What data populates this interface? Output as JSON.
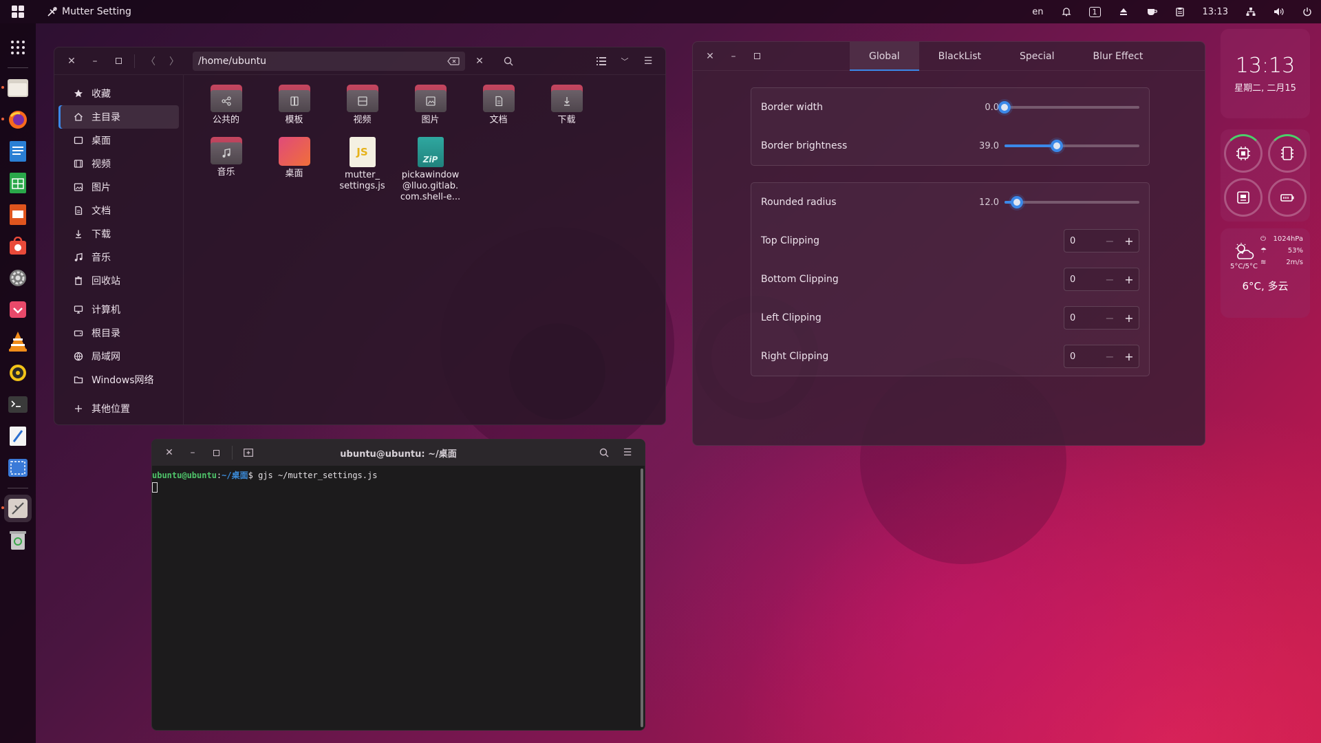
{
  "topbar": {
    "app_name": "Mutter Setting",
    "lang": "en",
    "time": "13:13",
    "workspace": "1"
  },
  "dock": {
    "items": [
      "files-icon",
      "firefox-icon",
      "writer-icon",
      "calc-icon",
      "impress-icon",
      "software-icon",
      "settings-icon",
      "gnome-extension-icon",
      "vlc-icon",
      "rhythmbox-icon",
      "terminal-icon",
      "text-editor-icon",
      "screenshot-icon",
      "mutter-setting-icon",
      "trash-icon"
    ]
  },
  "file_manager": {
    "path": "/home/ubuntu",
    "sidebar": [
      {
        "label": "收藏",
        "icon": "star-icon"
      },
      {
        "label": "主目录",
        "icon": "home-icon",
        "selected": true
      },
      {
        "label": "桌面",
        "icon": "desktop-icon"
      },
      {
        "label": "视频",
        "icon": "video-icon"
      },
      {
        "label": "图片",
        "icon": "picture-icon"
      },
      {
        "label": "文档",
        "icon": "document-icon"
      },
      {
        "label": "下载",
        "icon": "download-icon"
      },
      {
        "label": "音乐",
        "icon": "music-icon"
      },
      {
        "label": "回收站",
        "icon": "trash-icon"
      },
      {
        "label": "计算机",
        "icon": "computer-icon"
      },
      {
        "label": "根目录",
        "icon": "drive-icon"
      },
      {
        "label": "局域网",
        "icon": "network-icon"
      },
      {
        "label": "Windows网络",
        "icon": "folder-icon"
      },
      {
        "label": "其他位置",
        "icon": "plus-icon"
      }
    ],
    "files": [
      {
        "label": "公共的",
        "type": "folder",
        "glyph": "share"
      },
      {
        "label": "模板",
        "type": "folder",
        "glyph": "template"
      },
      {
        "label": "视频",
        "type": "folder",
        "glyph": "video"
      },
      {
        "label": "图片",
        "type": "folder",
        "glyph": "picture"
      },
      {
        "label": "文档",
        "type": "folder",
        "glyph": "document"
      },
      {
        "label": "下载",
        "type": "folder",
        "glyph": "download"
      },
      {
        "label": "音乐",
        "type": "folder",
        "glyph": "music"
      },
      {
        "label": "桌面",
        "type": "desktop"
      },
      {
        "label": "mutter_\nsettings.js",
        "type": "js"
      },
      {
        "label": "pickawindow\n@lluo.gitlab.\ncom.shell-e...",
        "type": "zip"
      }
    ],
    "js_badge": "JS",
    "zip_badge": "ZiP"
  },
  "terminal": {
    "title": "ubuntu@ubuntu: ~/桌面",
    "prompt_user": "ubuntu@ubuntu",
    "prompt_sep": ":",
    "prompt_dir": "~/桌面",
    "prompt_end": "$ ",
    "command": "gjs ~/mutter_settings.js"
  },
  "mutter": {
    "tabs": [
      "Global",
      "BlackList",
      "Special",
      "Blur Effect"
    ],
    "active_tab": 0,
    "border_width": {
      "label": "Border width",
      "value": "0.0",
      "fraction": 0.0
    },
    "border_brightness": {
      "label": "Border brightness",
      "value": "39.0",
      "fraction": 0.39
    },
    "rounded_radius": {
      "label": "Rounded radius",
      "value": "12.0",
      "fraction": 0.09
    },
    "clippings": [
      {
        "label": "Top Clipping",
        "value": "0"
      },
      {
        "label": "Bottom Clipping",
        "value": "0"
      },
      {
        "label": "Left Clipping",
        "value": "0"
      },
      {
        "label": "Right Clipping",
        "value": "0"
      }
    ]
  },
  "widgets": {
    "clock_time": "13:13",
    "clock_date": "星期二, 二月15",
    "weather": {
      "temp_range": "5°C/5°C",
      "pressure": "1024hPa",
      "humidity": "53%",
      "wind": "2m/s",
      "summary": "6°C, 多云"
    }
  }
}
